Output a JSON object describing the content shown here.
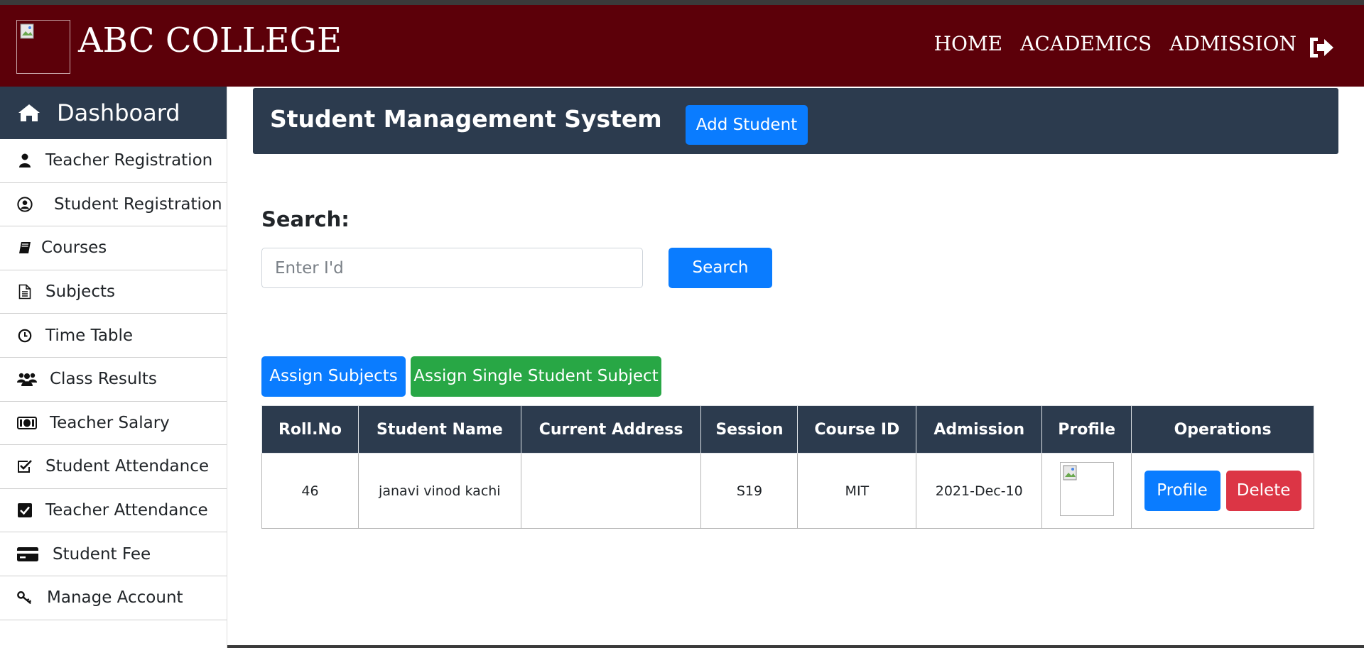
{
  "header": {
    "brand": "ABC COLLEGE",
    "nav": [
      "HOME",
      "ACADEMICS",
      "ADMISSION"
    ],
    "logout_icon": "sign-out-icon"
  },
  "sidebar": {
    "dashboard": "Dashboard",
    "items": [
      {
        "label": "Teacher Registration",
        "icon": "user-icon"
      },
      {
        "label": "Student Registration",
        "icon": "user-circle-icon"
      },
      {
        "label": "Courses",
        "icon": "book-icon"
      },
      {
        "label": "Subjects",
        "icon": "file-icon"
      },
      {
        "label": "Time Table",
        "icon": "clock-icon"
      },
      {
        "label": "Class Results",
        "icon": "users-icon"
      },
      {
        "label": "Teacher Salary",
        "icon": "money-icon"
      },
      {
        "label": "Student Attendance",
        "icon": "check-square-outline-icon"
      },
      {
        "label": "Teacher Attendance",
        "icon": "check-square-icon"
      },
      {
        "label": "Student Fee",
        "icon": "credit-card-icon"
      },
      {
        "label": "Manage Account",
        "icon": "key-icon"
      }
    ]
  },
  "main": {
    "title": "Student Management System",
    "add_student": "Add Student",
    "search_label": "Search:",
    "search_placeholder": "Enter I'd",
    "search_button": "Search",
    "assign_subjects": "Assign Subjects",
    "assign_single": "Assign Single Student Subject"
  },
  "table": {
    "headers": [
      "Roll.No",
      "Student Name",
      "Current Address",
      "Session",
      "Course ID",
      "Admission",
      "Profile",
      "Operations"
    ],
    "rows": [
      {
        "roll": "46",
        "name": "janavi vinod kachi",
        "address": "",
        "session": "S19",
        "course": "MIT",
        "admission": "2021-Dec-10",
        "profile_btn": "Profile",
        "delete_btn": "Delete"
      }
    ]
  },
  "colors": {
    "header_bg": "#5c0009",
    "panel_bg": "#2c3b4e",
    "primary": "#0a7cff",
    "success": "#28a745",
    "danger": "#dc3545"
  }
}
